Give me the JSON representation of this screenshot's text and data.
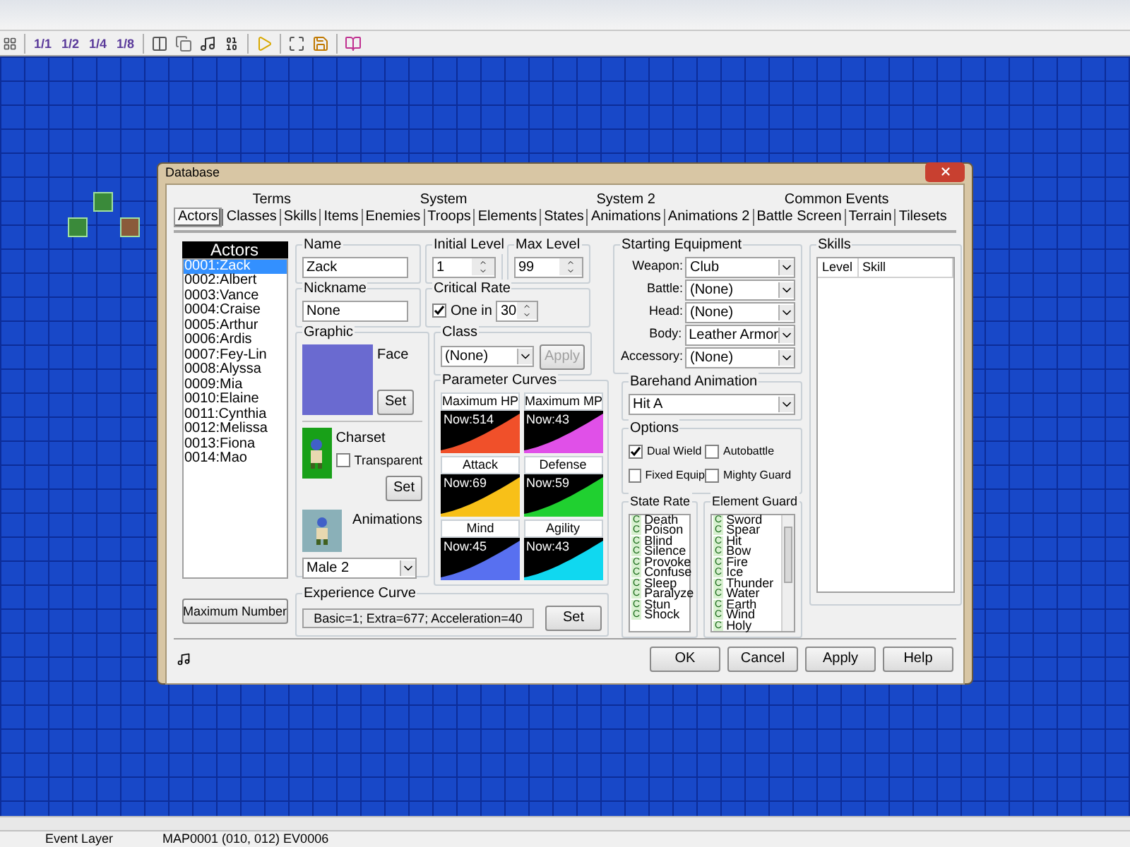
{
  "toolbar": {
    "zoom_buttons": [
      "1/1",
      "1/2",
      "1/4",
      "1/8"
    ]
  },
  "status_bar": {
    "layer": "Event Layer",
    "position": "MAP0001 (010, 012) EV0006"
  },
  "dialog": {
    "title": "Database",
    "tabs_top": [
      {
        "label": "Terms",
        "selected": false
      },
      {
        "label": "System",
        "selected": false
      },
      {
        "label": "System 2",
        "selected": false
      },
      {
        "label": "Common Events",
        "selected": false
      }
    ],
    "tabs_bottom": [
      {
        "label": "Actors",
        "selected": true
      },
      {
        "label": "Classes",
        "selected": false
      },
      {
        "label": "Skills",
        "selected": false
      },
      {
        "label": "Items",
        "selected": false
      },
      {
        "label": "Enemies",
        "selected": false
      },
      {
        "label": "Troops",
        "selected": false
      },
      {
        "label": "Elements",
        "selected": false
      },
      {
        "label": "States",
        "selected": false
      },
      {
        "label": "Animations",
        "selected": false
      },
      {
        "label": "Animations 2",
        "selected": false
      },
      {
        "label": "Battle Screen",
        "selected": false
      },
      {
        "label": "Terrain",
        "selected": false
      },
      {
        "label": "Tilesets",
        "selected": false
      }
    ],
    "actors": {
      "heading": "Actors",
      "items": [
        {
          "label": "0001:Zack",
          "selected": true
        },
        {
          "label": "0002:Albert",
          "selected": false
        },
        {
          "label": "0003:Vance",
          "selected": false
        },
        {
          "label": "0004:Craise",
          "selected": false
        },
        {
          "label": "0005:Arthur",
          "selected": false
        },
        {
          "label": "0006:Ardis",
          "selected": false
        },
        {
          "label": "0007:Fey-Lin",
          "selected": false
        },
        {
          "label": "0008:Alyssa",
          "selected": false
        },
        {
          "label": "0009:Mia",
          "selected": false
        },
        {
          "label": "0010:Elaine",
          "selected": false
        },
        {
          "label": "0011:Cynthia",
          "selected": false
        },
        {
          "label": "0012:Melissa",
          "selected": false
        },
        {
          "label": "0013:Fiona",
          "selected": false
        },
        {
          "label": "0014:Mao",
          "selected": false
        }
      ],
      "button": "Maximum Number"
    },
    "name": {
      "label": "Name",
      "value": "Zack"
    },
    "initial_level": {
      "label": "Initial Level",
      "value": "1"
    },
    "max_level": {
      "label": "Max Level",
      "value": "99"
    },
    "nickname": {
      "label": "Nickname",
      "value": "None"
    },
    "critical_rate": {
      "label": "Critical Rate",
      "checkbox_label": "One in",
      "checked": true,
      "value": "30"
    },
    "graphic": {
      "label": "Graphic",
      "face_label": "Face",
      "face_button": "Set",
      "charset_label": "Charset",
      "transparent_label": "Transparent",
      "transparent_checked": false,
      "charset_button": "Set",
      "animations_label": "Animations",
      "animations_value": "Male 2"
    },
    "class": {
      "label": "Class",
      "value": "(None)",
      "button": "Apply",
      "button_disabled": true
    },
    "parameter_curves": {
      "label": "Parameter Curves",
      "curves": [
        {
          "name": "Maximum HP",
          "reading": "Now:514",
          "color": "#f0502a"
        },
        {
          "name": "Maximum MP",
          "reading": "Now:43",
          "color": "#e050e8"
        },
        {
          "name": "Attack",
          "reading": "Now:69",
          "color": "#f8c018"
        },
        {
          "name": "Defense",
          "reading": "Now:59",
          "color": "#20d030"
        },
        {
          "name": "Mind",
          "reading": "Now:45",
          "color": "#5870f0"
        },
        {
          "name": "Agility",
          "reading": "Now:43",
          "color": "#10d8f0"
        }
      ]
    },
    "experience_curve": {
      "label": "Experience Curve",
      "value": "Basic=1; Extra=677; Acceleration=40",
      "button": "Set"
    },
    "starting_equipment": {
      "label": "Starting Equipment",
      "slots": [
        {
          "label": "Weapon:",
          "value": "Club"
        },
        {
          "label": "Battle:",
          "value": "(None)"
        },
        {
          "label": "Head:",
          "value": "(None)"
        },
        {
          "label": "Body:",
          "value": "Leather Armor"
        },
        {
          "label": "Accessory:",
          "value": "(None)"
        }
      ]
    },
    "barehand_animation": {
      "label": "Barehand Animation",
      "value": "Hit A"
    },
    "options": {
      "label": "Options",
      "items": [
        {
          "label": "Dual Wield",
          "checked": true
        },
        {
          "label": "Autobattle",
          "checked": false
        },
        {
          "label": "Fixed Equip",
          "checked": false
        },
        {
          "label": "Mighty Guard",
          "checked": false
        }
      ]
    },
    "state_rate": {
      "label": "State Rate",
      "items": [
        {
          "rank": "C",
          "name": "Death"
        },
        {
          "rank": "C",
          "name": "Poison"
        },
        {
          "rank": "C",
          "name": "Blind"
        },
        {
          "rank": "C",
          "name": "Silence"
        },
        {
          "rank": "C",
          "name": "Provoke"
        },
        {
          "rank": "C",
          "name": "Confuse"
        },
        {
          "rank": "C",
          "name": "Sleep"
        },
        {
          "rank": "C",
          "name": "Paralyze"
        },
        {
          "rank": "C",
          "name": "Stun"
        },
        {
          "rank": "C",
          "name": "Shock"
        }
      ]
    },
    "element_guard": {
      "label": "Element Guard",
      "items": [
        {
          "rank": "C",
          "name": "Sword"
        },
        {
          "rank": "C",
          "name": "Spear"
        },
        {
          "rank": "C",
          "name": "Hit"
        },
        {
          "rank": "C",
          "name": "Bow"
        },
        {
          "rank": "C",
          "name": "Fire"
        },
        {
          "rank": "C",
          "name": "Ice"
        },
        {
          "rank": "C",
          "name": "Thunder"
        },
        {
          "rank": "C",
          "name": "Water"
        },
        {
          "rank": "C",
          "name": "Earth"
        },
        {
          "rank": "C",
          "name": "Wind"
        },
        {
          "rank": "C",
          "name": "Holy"
        }
      ]
    },
    "skills": {
      "label": "Skills",
      "columns": [
        "Level",
        "Skill"
      ]
    },
    "buttons": [
      "OK",
      "Cancel",
      "Apply",
      "Help"
    ]
  }
}
